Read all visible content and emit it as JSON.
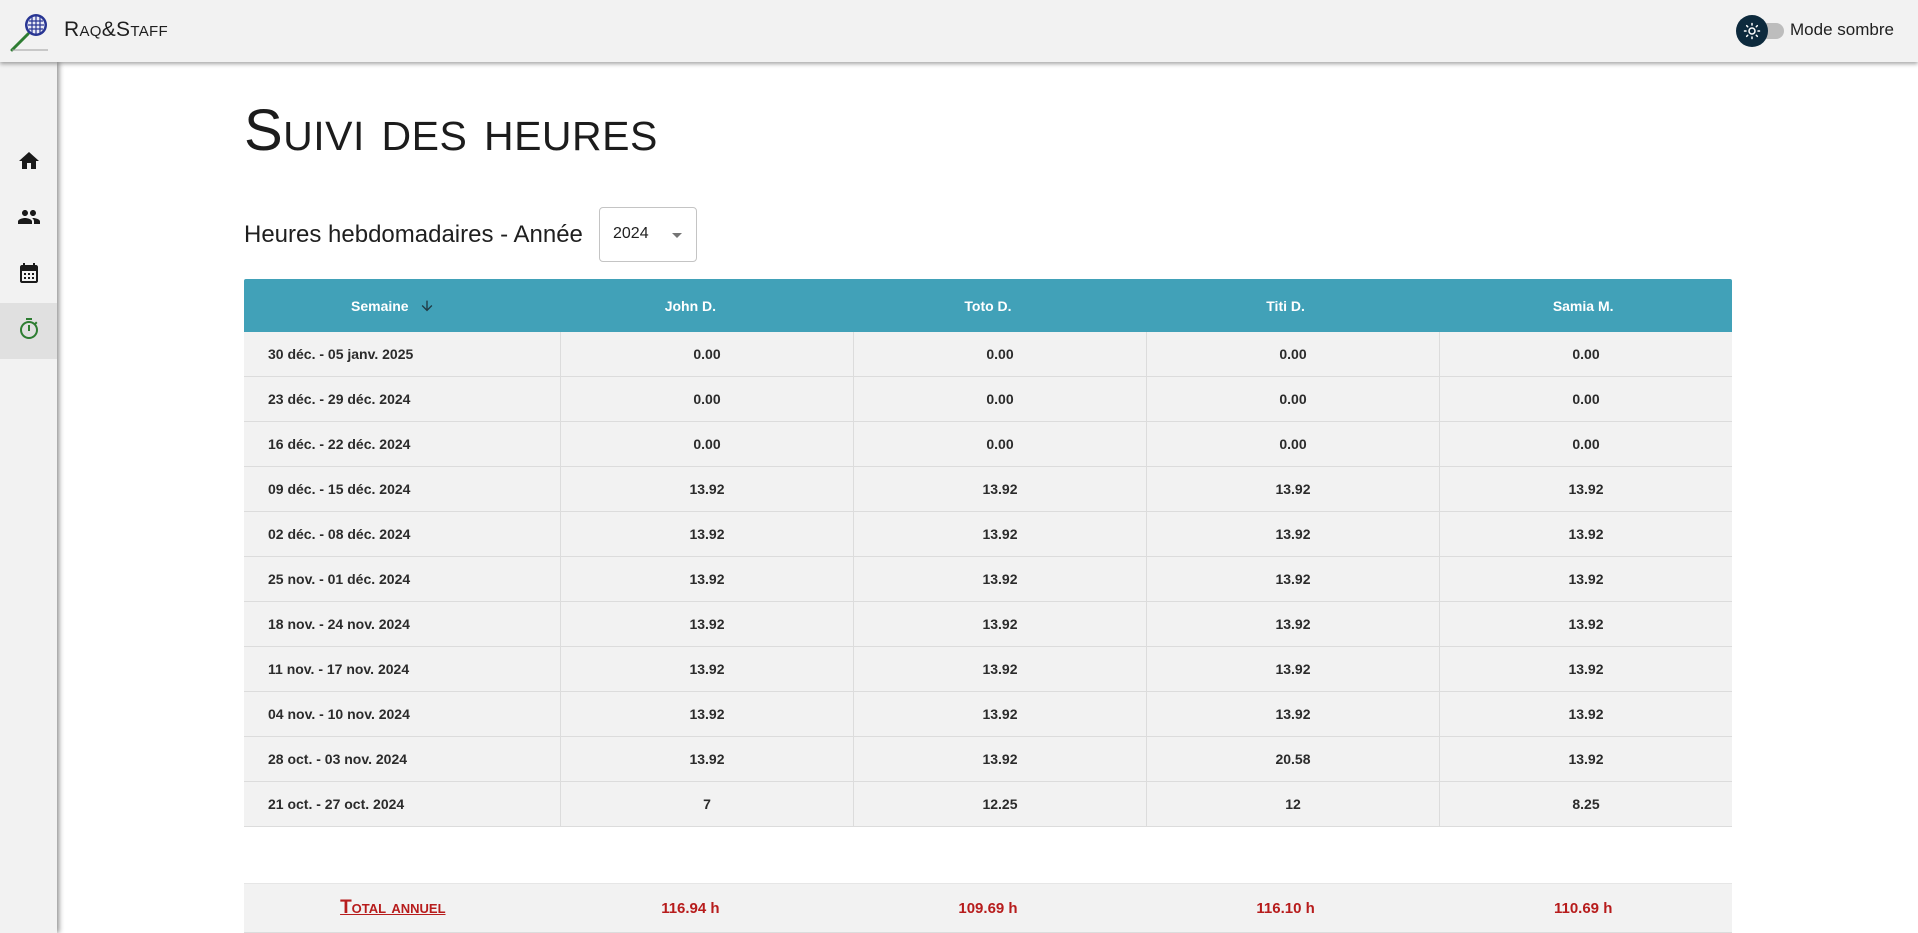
{
  "app": {
    "brand": "Raq&Staff",
    "theme_label": "Mode sombre"
  },
  "sidebar": {
    "items": [
      {
        "name": "home",
        "icon": "home-icon",
        "active": false
      },
      {
        "name": "staff",
        "icon": "people-icon",
        "active": false
      },
      {
        "name": "calendar",
        "icon": "calendar-icon",
        "active": false
      },
      {
        "name": "timer",
        "icon": "timer-icon",
        "active": true
      }
    ]
  },
  "page": {
    "title": "Suivi des heures"
  },
  "filter": {
    "label": "Heures hebdomadaires - Année",
    "year": "2024"
  },
  "table": {
    "headers": [
      "Semaine",
      "John D.",
      "Toto D.",
      "Titi D.",
      "Samia M."
    ],
    "rows": [
      [
        "30 déc. - 05 janv. 2025",
        "0.00",
        "0.00",
        "0.00",
        "0.00"
      ],
      [
        "23 déc. - 29 déc. 2024",
        "0.00",
        "0.00",
        "0.00",
        "0.00"
      ],
      [
        "16 déc. - 22 déc. 2024",
        "0.00",
        "0.00",
        "0.00",
        "0.00"
      ],
      [
        "09 déc. - 15 déc. 2024",
        "13.92",
        "13.92",
        "13.92",
        "13.92"
      ],
      [
        "02 déc. - 08 déc. 2024",
        "13.92",
        "13.92",
        "13.92",
        "13.92"
      ],
      [
        "25 nov. - 01 déc. 2024",
        "13.92",
        "13.92",
        "13.92",
        "13.92"
      ],
      [
        "18 nov. - 24 nov. 2024",
        "13.92",
        "13.92",
        "13.92",
        "13.92"
      ],
      [
        "11 nov. - 17 nov. 2024",
        "13.92",
        "13.92",
        "13.92",
        "13.92"
      ],
      [
        "04 nov. - 10 nov. 2024",
        "13.92",
        "13.92",
        "13.92",
        "13.92"
      ],
      [
        "28 oct. - 03 nov. 2024",
        "13.92",
        "13.92",
        "20.58",
        "13.92"
      ],
      [
        "21 oct. - 27 oct. 2024",
        "7",
        "12.25",
        "12",
        "8.25"
      ]
    ],
    "footer": {
      "label": "Total annuel",
      "totals": [
        "116.94 h",
        "109.69 h",
        "116.10 h",
        "110.69 h"
      ]
    }
  },
  "colors": {
    "header_bg": "#41a1b8",
    "total_text": "#b71c1c",
    "active_nav_icon": "#2e7d32",
    "toggle_thumb": "#0d2a3d"
  }
}
